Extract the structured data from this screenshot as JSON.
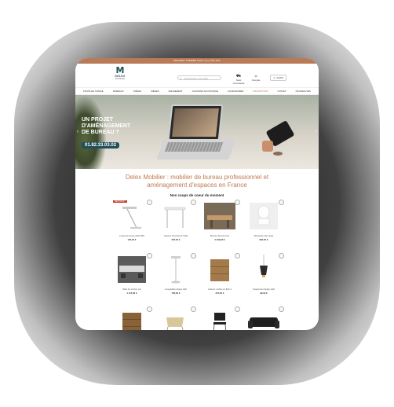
{
  "topbar": {
    "text": "DELIVERY SUMMER SALE: up to 70% OFF"
  },
  "header": {
    "logo": "DELEX",
    "logo_sub": "MOBILIER",
    "search_placeholder": "Rechercher un produit",
    "icons": [
      {
        "label": "Suivi commande"
      },
      {
        "label": "Compte"
      }
    ],
    "cart_label": "0,00 €"
  },
  "nav": {
    "items": [
      {
        "label": "POSTE DE TRAVAIL"
      },
      {
        "label": "BUREAUX"
      },
      {
        "label": "TABLES"
      },
      {
        "label": "SIÈGES"
      },
      {
        "label": "RANGEMENT"
      },
      {
        "label": "CLOISONS ACOUSTIQUE"
      },
      {
        "label": "ACCESSOIRES"
      },
      {
        "label": "PROMOTIONS"
      },
      {
        "label": "OUTLET"
      },
      {
        "label": "NOUVEAUTÉS"
      }
    ]
  },
  "hero": {
    "line1": "UN PROJET",
    "line2": "D'AMÉNAGEMENT",
    "line3": "DE BUREAU ?",
    "phone": "01.82.33.03.02"
  },
  "main": {
    "heading_line1": "Delex Mobilier : mobilier de bureau professionnel et",
    "heading_line2": "aménagement d'espaces en France",
    "subheading": "Nos coups de coeur du moment"
  },
  "products": [
    {
      "name": "Lampe de bureau LED ABS",
      "price": "105,00 €",
      "badge": "DÉSTOCK !",
      "icon": "desk-lamp"
    },
    {
      "name": "Caisson d'accueil de Table",
      "price": "255,00 €",
      "badge": "",
      "icon": "table"
    },
    {
      "name": "Bureau Réunion bois",
      "price": "2 349,00 €",
      "badge": "",
      "icon": "meeting-table"
    },
    {
      "name": "Banquette toile beige",
      "price": "884,00 €",
      "badge": "",
      "icon": "chair"
    },
    {
      "name": "Table de réunion noir",
      "price": "1 115,00 €",
      "badge": "",
      "icon": "meeting-room"
    },
    {
      "name": "Lampadaire design LED",
      "price": "735,00 €",
      "badge": "",
      "icon": "floor-lamp"
    },
    {
      "name": "Caisson mobile sur Bois 3",
      "price": "374,00 €",
      "badge": "",
      "icon": "drawer-cabinet"
    },
    {
      "name": "Suspension design LED",
      "price": "99,00 €",
      "badge": "",
      "icon": "pendant-lamp"
    },
    {
      "name": "",
      "price": "",
      "badge": "",
      "icon": "drawer-cabinet"
    },
    {
      "name": "",
      "price": "",
      "badge": "",
      "icon": "lounge-chair"
    },
    {
      "name": "",
      "price": "",
      "badge": "",
      "icon": "stacking-chair"
    },
    {
      "name": "",
      "price": "",
      "badge": "",
      "icon": "sofa"
    }
  ],
  "colors": {
    "accent": "#b97a58",
    "brand": "#1f4f5a"
  }
}
